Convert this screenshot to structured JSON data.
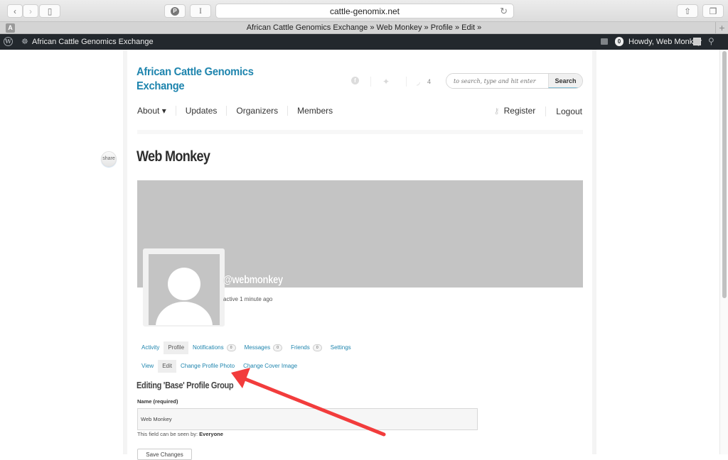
{
  "browser": {
    "url": "cattle-genomix.net",
    "tab_title": "African Cattle Genomics Exchange » Web Monkey » Profile » Edit »",
    "tab_favicon_letter": "A",
    "reader_label": "I",
    "icons": {
      "back": "‹",
      "forward": "›",
      "sidebar": "▯",
      "pinterest": "P",
      "reload": "↻",
      "share": "⇧",
      "tabs": "❐",
      "new_tab": "+"
    }
  },
  "adminbar": {
    "site_name": "African Cattle Genomics Exchange",
    "notification_count": "0",
    "howdy": "Howdy, Web Monkey",
    "wp_logo": "W",
    "dashboard_icon": "☸",
    "search_icon": "⚲"
  },
  "site": {
    "brand_line1": "African Cattle Genomics",
    "brand_line2": "Exchange",
    "rss_count": "4",
    "social_icons": {
      "facebook": "f",
      "twitter": "✦",
      "rss": "◞"
    },
    "search": {
      "placeholder": "to search, type and hit enter",
      "button": "Search"
    },
    "nav": [
      {
        "label": "About ▾"
      },
      {
        "label": "Updates"
      },
      {
        "label": "Organizers"
      },
      {
        "label": "Members"
      }
    ],
    "user_nav": {
      "register": "Register",
      "logout": "Logout",
      "key_icon": "⚷"
    },
    "share_label": "share"
  },
  "profile": {
    "title": "Web Monkey",
    "handle": "@webmonkey",
    "activity": "active 1 minute ago",
    "tabs": [
      {
        "label": "Activity",
        "active": false
      },
      {
        "label": "Profile",
        "active": true
      },
      {
        "label": "Notifications",
        "badge": "0"
      },
      {
        "label": "Messages",
        "badge": "0"
      },
      {
        "label": "Friends",
        "badge": "0"
      },
      {
        "label": "Settings"
      }
    ],
    "subtabs": [
      {
        "label": "View"
      },
      {
        "label": "Edit",
        "active": true
      },
      {
        "label": "Change Profile Photo"
      },
      {
        "label": "Change Cover Image"
      }
    ],
    "form": {
      "section_title": "Editing 'Base' Profile Group",
      "name_label": "Name (required)",
      "name_value": "Web Monkey",
      "visibility_prefix": "This field can be seen by:",
      "visibility_value": "Everyone",
      "save_button": "Save Changes"
    }
  },
  "annotation": {
    "color": "#f23c3c",
    "points_to": "Change Profile Photo"
  }
}
